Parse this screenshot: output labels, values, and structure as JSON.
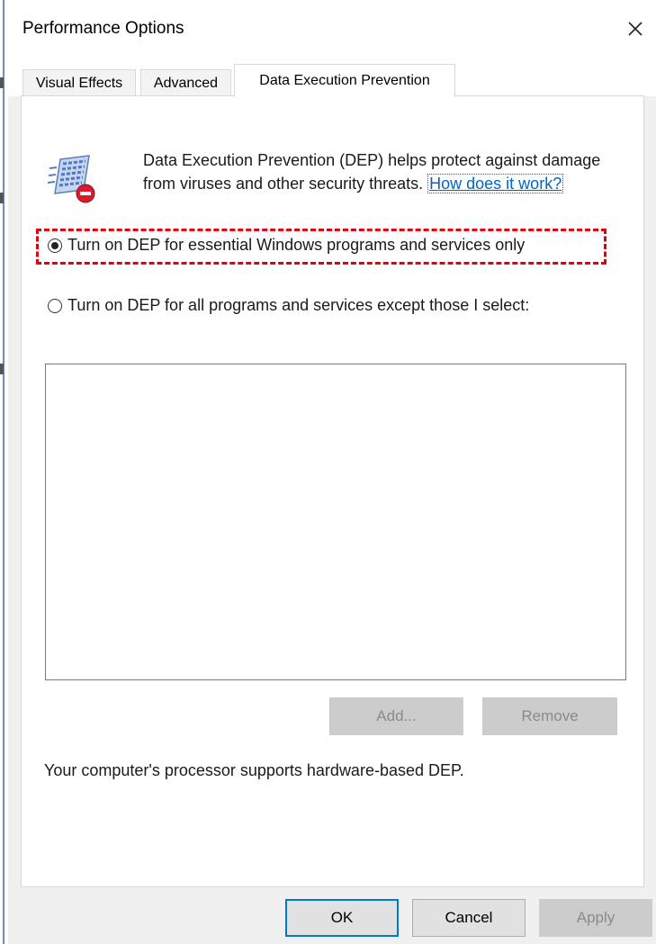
{
  "window": {
    "title": "Performance Options",
    "close_label": "×"
  },
  "tabs": [
    {
      "label": "Visual Effects",
      "active": false
    },
    {
      "label": "Advanced",
      "active": false
    },
    {
      "label": "Data Execution Prevention",
      "active": true
    }
  ],
  "dep": {
    "description": "Data Execution Prevention (DEP) helps protect against damage from viruses and other security threats.",
    "help_link": "How does it work?",
    "options": [
      {
        "label": "Turn on DEP for essential Windows programs and services only",
        "selected": true
      },
      {
        "label": "Turn on DEP for all programs and services except those I select:",
        "selected": false
      }
    ],
    "exceptions_list": [],
    "add_label": "Add...",
    "remove_label": "Remove",
    "status": "Your computer's processor supports hardware-based DEP."
  },
  "footer": {
    "ok_label": "OK",
    "cancel_label": "Cancel",
    "apply_label": "Apply"
  },
  "colors": {
    "accent": "#0078d7",
    "link": "#0066cc",
    "highlight_box": "#e0000e",
    "disabled_button": "#cccccc"
  }
}
